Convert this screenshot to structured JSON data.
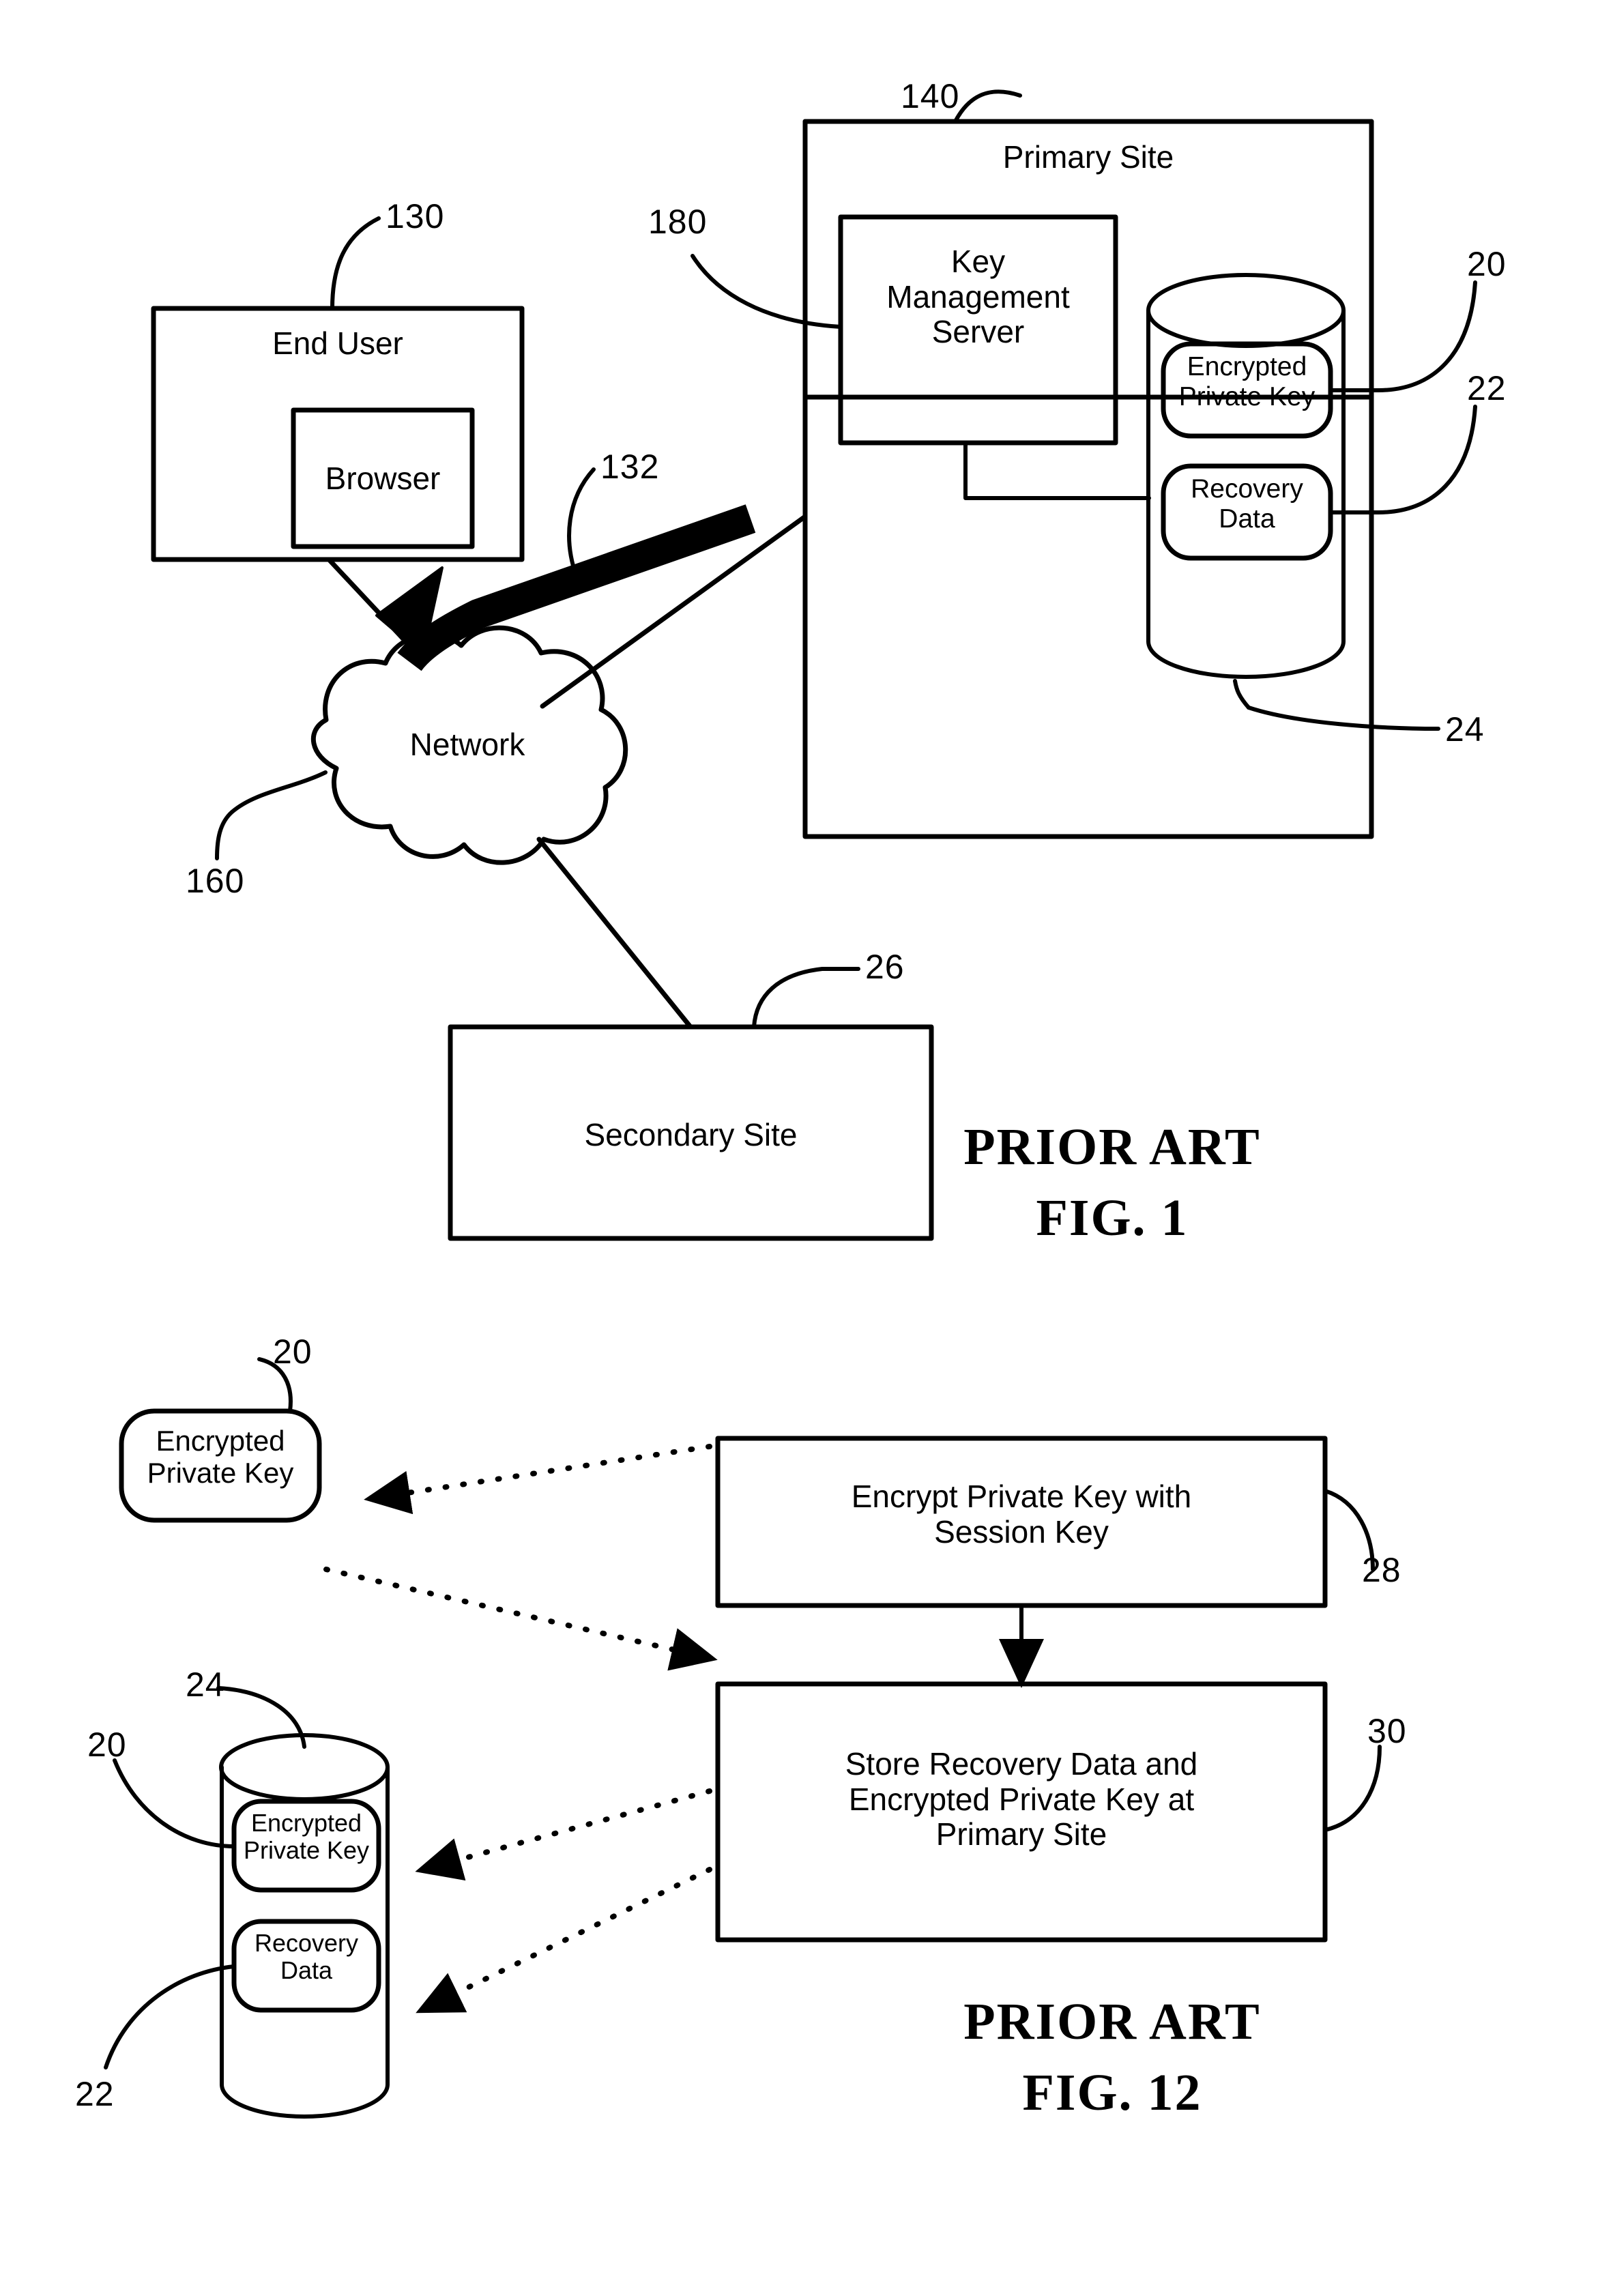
{
  "document": {
    "type": "patent-drawing-sheet",
    "figures": [
      {
        "id": "fig1",
        "title_line1": "PRIOR ART",
        "title_line2": "FIG. 1",
        "nodes": {
          "end_user": "End User",
          "browser": "Browser",
          "network": "Network",
          "secondary_site": "Secondary Site",
          "primary_site": "Primary Site",
          "key_management_server": "Key\nManagement\nServer",
          "encrypted_private_key": "Encrypted\nPrivate Key",
          "recovery_data": "Recovery\nData"
        },
        "reference_numerals": {
          "end_user": "130",
          "kms": "180",
          "thick_arrow": "132",
          "primary_site": "140",
          "network": "160",
          "encrypted_private_key": "20",
          "recovery_data": "22",
          "database": "24",
          "secondary_site": "26"
        }
      },
      {
        "id": "fig12",
        "title_line1": "PRIOR ART",
        "title_line2": "FIG. 12",
        "nodes": {
          "encrypted_private_key_standalone": "Encrypted\nPrivate Key",
          "encrypted_private_key_in_db": "Encrypted\nPrivate Key",
          "recovery_data_in_db": "Recovery\nData",
          "step_encrypt": "Encrypt Private Key with\nSession Key",
          "step_store": "Store Recovery Data and\nEncrypted Private Key at\nPrimary Site"
        },
        "reference_numerals": {
          "encrypted_private_key_standalone": "20",
          "step_encrypt": "28",
          "step_store": "30",
          "database": "24",
          "encrypted_private_key_in_db": "20",
          "recovery_data_in_db": "22"
        }
      }
    ]
  },
  "colors": {
    "ink": "#000000",
    "paper": "#ffffff"
  }
}
